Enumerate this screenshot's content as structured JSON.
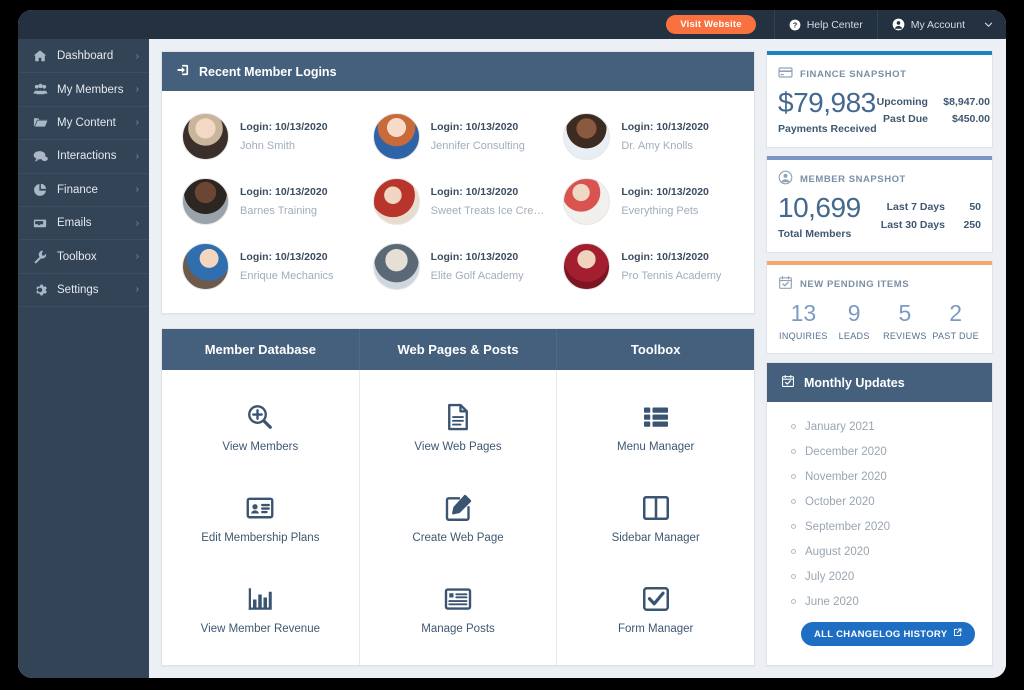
{
  "topbar": {
    "visit_website": "Visit Website",
    "help_center": "Help Center",
    "my_account": "My Account",
    "accent_color": "#f9713f",
    "background_color": "#243140"
  },
  "sidebar": {
    "background_color": "#334457",
    "items": [
      {
        "label": "Dashboard",
        "icon": "home-icon",
        "chevron": "›"
      },
      {
        "label": "My Members",
        "icon": "users-icon",
        "chevron": "›"
      },
      {
        "label": "My Content",
        "icon": "folder-icon",
        "chevron": "›"
      },
      {
        "label": "Interactions",
        "icon": "comment-icon",
        "chevron": "›"
      },
      {
        "label": "Finance",
        "icon": "pie-chart-icon",
        "chevron": "›"
      },
      {
        "label": "Emails",
        "icon": "inbox-icon",
        "chevron": "›"
      },
      {
        "label": "Toolbox",
        "icon": "wrench-icon",
        "chevron": "›"
      },
      {
        "label": "Settings",
        "icon": "gear-icon",
        "chevron": "›"
      }
    ]
  },
  "recent_logins": {
    "title": "Recent Member Logins",
    "icon": "sign-in-icon",
    "header_color": "#44607d",
    "members": [
      {
        "date": "Login: 10/13/2020",
        "name": "John Smith"
      },
      {
        "date": "Login: 10/13/2020",
        "name": "Jennifer Consulting"
      },
      {
        "date": "Login: 10/13/2020",
        "name": "Dr. Amy Knolls"
      },
      {
        "date": "Login: 10/13/2020",
        "name": "Barnes Training"
      },
      {
        "date": "Login: 10/13/2020",
        "name": "Sweet Treats Ice Cream"
      },
      {
        "date": "Login: 10/13/2020",
        "name": "Everything Pets"
      },
      {
        "date": "Login: 10/13/2020",
        "name": "Enrique Mechanics"
      },
      {
        "date": "Login: 10/13/2020",
        "name": "Elite Golf Academy"
      },
      {
        "date": "Login: 10/13/2020",
        "name": "Pro Tennis Academy"
      }
    ]
  },
  "quick_actions": {
    "columns": [
      {
        "header": "Member Database",
        "tiles": [
          {
            "label": "View Members",
            "icon": "search-plus-icon"
          },
          {
            "label": "Edit Membership Plans",
            "icon": "id-card-icon"
          },
          {
            "label": "View Member Revenue",
            "icon": "bar-chart-icon"
          }
        ]
      },
      {
        "header": "Web Pages & Posts",
        "tiles": [
          {
            "label": "View Web Pages",
            "icon": "document-icon"
          },
          {
            "label": "Create Web Page",
            "icon": "edit-pencil-icon"
          },
          {
            "label": "Manage Posts",
            "icon": "list-view-icon"
          }
        ]
      },
      {
        "header": "Toolbox",
        "tiles": [
          {
            "label": "Menu Manager",
            "icon": "menu-list-icon"
          },
          {
            "label": "Sidebar Manager",
            "icon": "columns-icon"
          },
          {
            "label": "Form Manager",
            "icon": "check-square-icon"
          }
        ]
      }
    ]
  },
  "finance_snapshot": {
    "title": "FINANCE SNAPSHOT",
    "icon": "credit-card-icon",
    "stripe_color": "#1b84bf",
    "amount": "$79,983",
    "amount_label": "Payments Received",
    "stats": [
      {
        "label": "Upcoming",
        "value": "$8,947.00"
      },
      {
        "label": "Past Due",
        "value": "$450.00"
      }
    ]
  },
  "member_snapshot": {
    "title": "MEMBER SNAPSHOT",
    "icon": "user-circle-icon",
    "stripe_color": "#7b96c4",
    "amount": "10,699",
    "amount_label": "Total Members",
    "stats": [
      {
        "label": "Last 7 Days",
        "value": "50"
      },
      {
        "label": "Last 30 Days",
        "value": "250"
      }
    ]
  },
  "pending_items": {
    "title": "NEW PENDING ITEMS",
    "icon": "calendar-check-icon",
    "stripe_color": "#f0ab6a",
    "items": [
      {
        "count": "13",
        "label": "INQUIRIES"
      },
      {
        "count": "9",
        "label": "LEADS"
      },
      {
        "count": "5",
        "label": "REVIEWS"
      },
      {
        "count": "2",
        "label": "PAST DUE"
      }
    ]
  },
  "monthly_updates": {
    "title": "Monthly Updates",
    "icon": "calendar-check-icon",
    "items": [
      "January 2021",
      "December 2020",
      "November 2020",
      "October 2020",
      "September 2020",
      "August 2020",
      "July 2020",
      "June 2020"
    ],
    "changelog_button": "ALL CHANGELOG HISTORY",
    "changelog_icon": "external-link-icon"
  }
}
